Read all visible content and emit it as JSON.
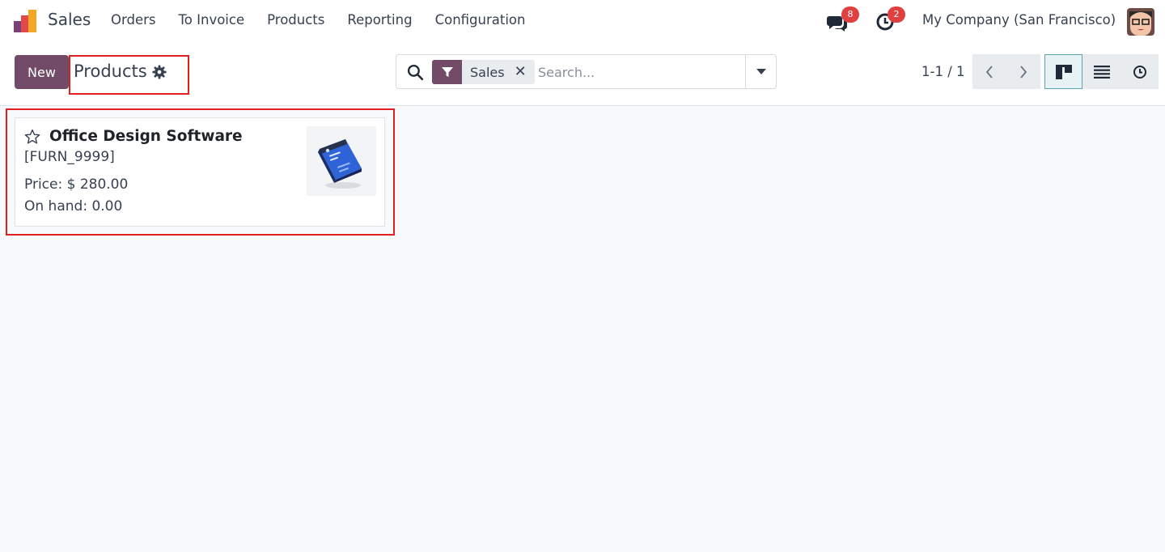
{
  "navbar": {
    "app_name": "Sales",
    "menu": [
      {
        "label": "Orders"
      },
      {
        "label": "To Invoice"
      },
      {
        "label": "Products"
      },
      {
        "label": "Reporting"
      },
      {
        "label": "Configuration"
      }
    ],
    "messages_count": "8",
    "activities_count": "2",
    "company": "My Company (San Francisco)"
  },
  "control": {
    "new_label": "New",
    "breadcrumb": "Products",
    "search": {
      "facet_label": "Sales",
      "placeholder": "Search..."
    },
    "pager": "1-1 / 1"
  },
  "product": {
    "name": "Office Design Software",
    "reference": "[FURN_9999]",
    "price": "Price: $ 280.00",
    "on_hand": "On hand: 0.00"
  },
  "colors": {
    "brand": "#714b67",
    "badge": "#e0403f",
    "highlight": "#e02020"
  }
}
